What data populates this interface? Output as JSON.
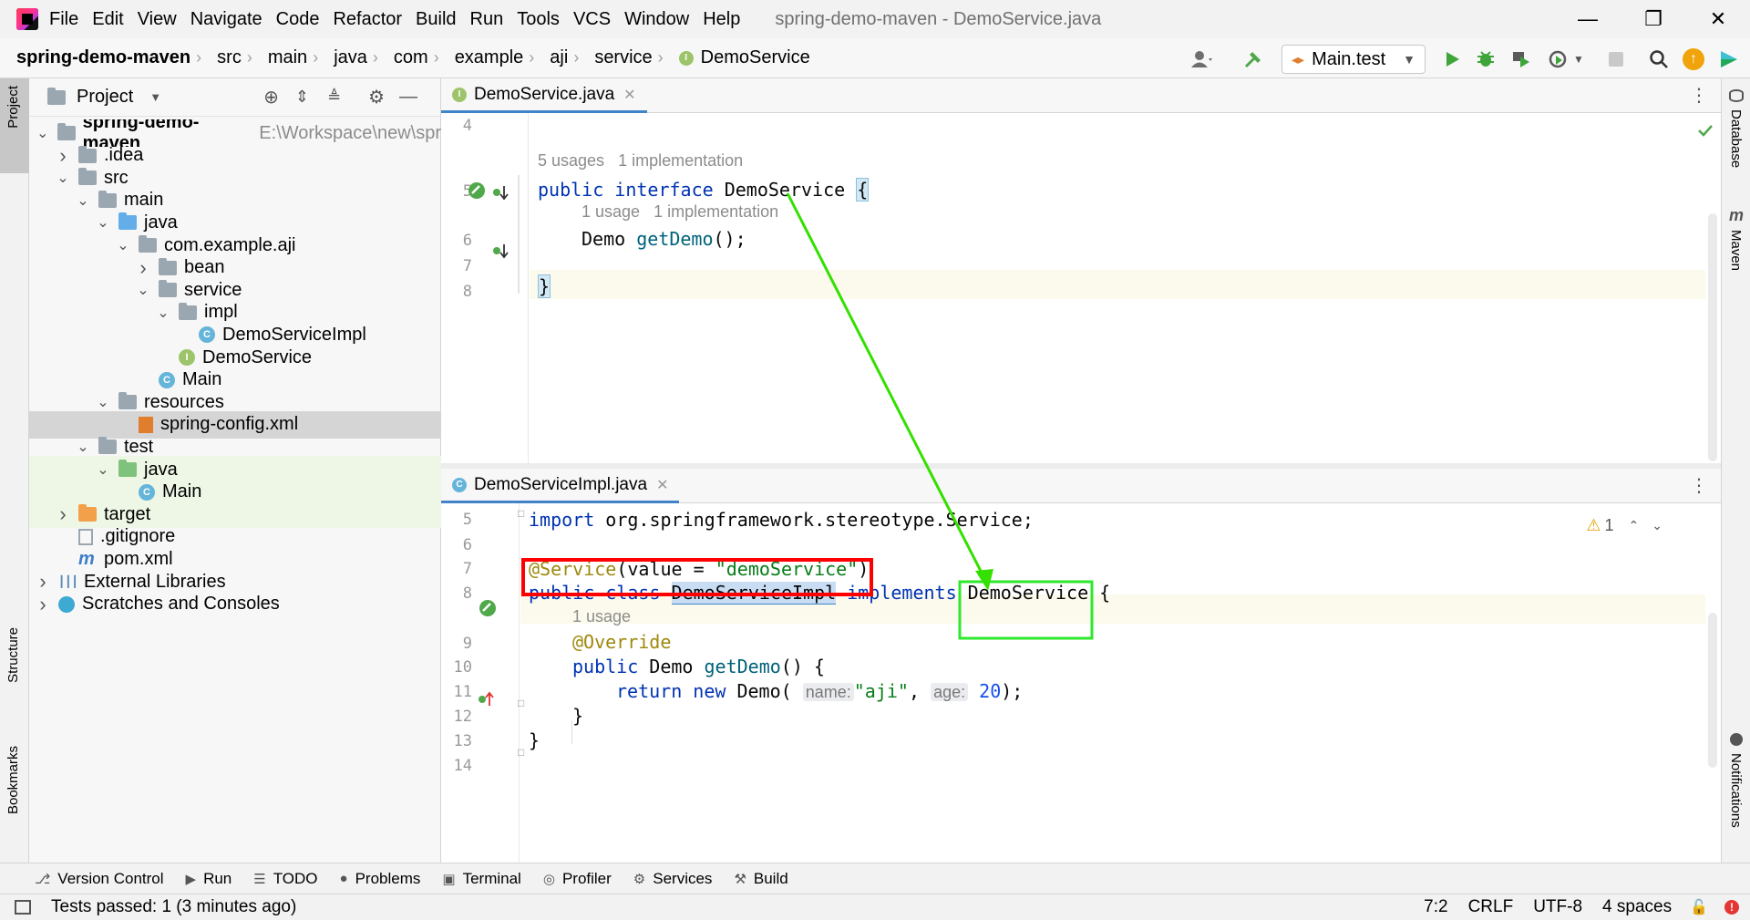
{
  "window_title": "spring-demo-maven - DemoService.java",
  "menu": [
    "File",
    "Edit",
    "View",
    "Navigate",
    "Code",
    "Refactor",
    "Build",
    "Run",
    "Tools",
    "VCS",
    "Window",
    "Help"
  ],
  "breadcrumb": [
    "spring-demo-maven",
    "src",
    "main",
    "java",
    "com",
    "example",
    "aji",
    "service",
    "DemoService"
  ],
  "run_config": "Main.test",
  "project_panel": {
    "title": "Project",
    "tree": [
      {
        "label": "spring-demo-maven",
        "path": "E:\\Workspace\\new\\spr",
        "bold": true
      },
      {
        "label": ".idea"
      },
      {
        "label": "src"
      },
      {
        "label": "main"
      },
      {
        "label": "java"
      },
      {
        "label": "com.example.aji"
      },
      {
        "label": "bean"
      },
      {
        "label": "service"
      },
      {
        "label": "impl"
      },
      {
        "label": "DemoServiceImpl"
      },
      {
        "label": "DemoService"
      },
      {
        "label": "Main"
      },
      {
        "label": "resources"
      },
      {
        "label": "spring-config.xml"
      },
      {
        "label": "test"
      },
      {
        "label": "java"
      },
      {
        "label": "Main"
      },
      {
        "label": "target"
      },
      {
        "label": ".gitignore"
      },
      {
        "label": "pom.xml"
      },
      {
        "label": "External Libraries"
      },
      {
        "label": "Scratches and Consoles"
      }
    ]
  },
  "editor_top": {
    "tab": "DemoService.java",
    "lines": [
      "4",
      "5",
      "6",
      "7",
      "8"
    ],
    "hint_usages": "5 usages",
    "hint_impl": "1 implementation",
    "hint_usage2": "1 usage",
    "hint_impl2": "1 implementation"
  },
  "editor_bottom": {
    "tab": "DemoServiceImpl.java",
    "lines": [
      "5",
      "6",
      "7",
      "8",
      "9",
      "10",
      "11",
      "12",
      "13",
      "14"
    ],
    "hint_usage": "1 usage",
    "warning_count": "1",
    "inlay_name": "name:",
    "inlay_age": "age:"
  },
  "left_tabs": {
    "project": "Project",
    "structure": "Structure",
    "bookmarks": "Bookmarks"
  },
  "right_tabs": {
    "database": "Database",
    "maven": "Maven",
    "notifications": "Notifications"
  },
  "tool_windows": [
    "Version Control",
    "Run",
    "TODO",
    "Problems",
    "Terminal",
    "Profiler",
    "Services",
    "Build"
  ],
  "status": {
    "message": "Tests passed: 1 (3 minutes ago)",
    "position": "7:2",
    "line_sep": "CRLF",
    "encoding": "UTF-8",
    "indent": "4 spaces"
  },
  "colors": {
    "highlight_red": "#ff0000",
    "highlight_green": "#2ee82e",
    "arrow": "#33e000",
    "accent": "#4083c9"
  }
}
